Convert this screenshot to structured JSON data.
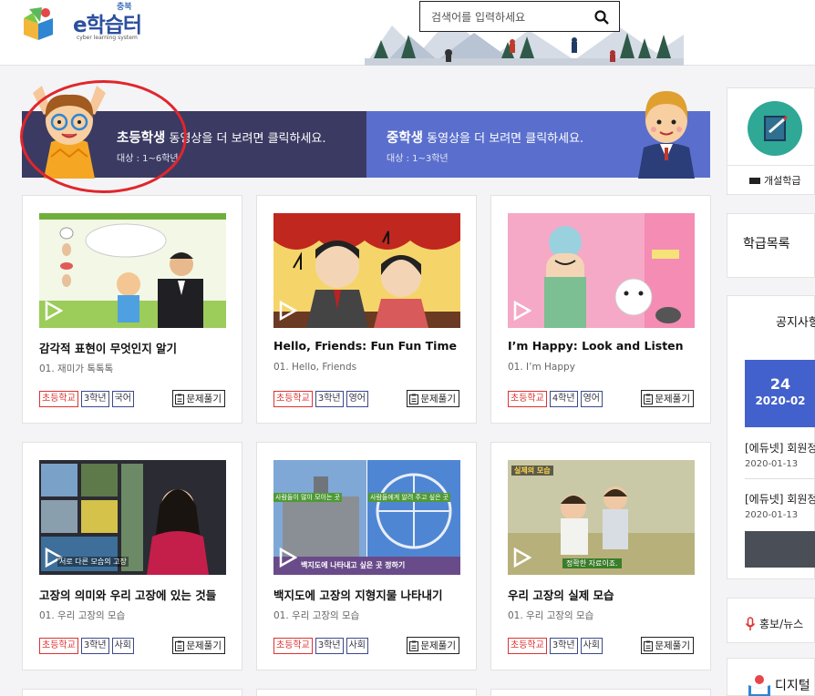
{
  "header": {
    "logo_small": "충북",
    "logo_main": "e학습터",
    "logo_sub": "cyber learning system",
    "search_placeholder": "검색어를 입력하세요"
  },
  "banner": {
    "elementary": {
      "title_strong": "초등학생",
      "title_rest": " 동영상을 더 보려면 클릭하세요.",
      "sub": "대상 : 1~6학년"
    },
    "middle": {
      "title_strong": "중학생",
      "title_rest": " 동영상을 더 보려면 클릭하세요.",
      "sub": "대상 : 1~3학년"
    }
  },
  "quiz_label": "문제풀기",
  "cards": [
    {
      "title": "감각적 표현이 무엇인지 알기",
      "subtitle": "01. 재미가 톡톡톡",
      "school": "초등학교",
      "grade": "3학년",
      "subject": "국어"
    },
    {
      "title": "Hello, Friends: Fun Fun Time",
      "subtitle": "01. Hello, Friends",
      "school": "초등학교",
      "grade": "3학년",
      "subject": "영어"
    },
    {
      "title": "I’m Happy: Look and Listen",
      "subtitle": "01. I’m Happy",
      "school": "초등학교",
      "grade": "4학년",
      "subject": "영어"
    },
    {
      "title": "고장의 의미와 우리 고장에 있는 것들",
      "subtitle": "01. 우리 고장의 모습",
      "school": "초등학교",
      "grade": "3학년",
      "subject": "사회"
    },
    {
      "title": "백지도에 고장의 지형지물 나타내기",
      "subtitle": "01. 우리 고장의 모습",
      "school": "초등학교",
      "grade": "3학년",
      "subject": "사회"
    },
    {
      "title": "우리 고장의 실제 모습",
      "subtitle": "01. 우리 고장의 모습",
      "school": "초등학교",
      "grade": "3학년",
      "subject": "사회"
    }
  ],
  "thumb_text": {
    "card4": "서로 다른 모습의 고장",
    "card5_main": "백지도에 나타내고 싶은 곳 정하기",
    "card5_left": "사람들이 많이 모이는 곳",
    "card5_right": "사람들에게 알려 주고 싶은 곳",
    "card6_top": "실제의 모습",
    "card6_bottom": "정확한 자료이죠."
  },
  "sidebar": {
    "open_class": "개설학급",
    "class_list": "학급목록",
    "notice_title": "공지사항",
    "notice_day": "24",
    "notice_month": "2020-02",
    "notices": [
      {
        "title": "[에듀넷] 회원정보",
        "date": "2020-01-13"
      },
      {
        "title": "[에듀넷] 회원정보",
        "date": "2020-01-13"
      }
    ],
    "news": "홍보/뉴스",
    "digital": "디지털"
  },
  "colors": {
    "banner_left": "#3b3a62",
    "banner_right": "#5a6fcd",
    "accent_red": "#e0262c",
    "notice_blue": "#4361cc",
    "teal": "#2fa896"
  }
}
